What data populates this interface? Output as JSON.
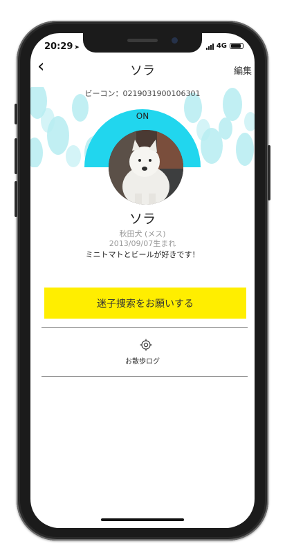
{
  "status_bar": {
    "time": "20:29",
    "network": "4G"
  },
  "nav": {
    "back_symbol": "‹",
    "title": "ソラ",
    "edit_label": "編集"
  },
  "beacon": {
    "label": "ビーコン：0219031900106301"
  },
  "status": {
    "on_label": "ON"
  },
  "pet": {
    "name": "ソラ",
    "breed": "秋田犬 (メス)",
    "birth": "2013/09/07生まれ",
    "description": "ミニトマトとビールが好きです！"
  },
  "actions": {
    "search_request_label": "迷子捜索をお願いする",
    "walk_log_label": "お散歩ログ"
  },
  "colors": {
    "accent_cyan": "#21d6ee",
    "button_yellow": "#ffee00"
  }
}
